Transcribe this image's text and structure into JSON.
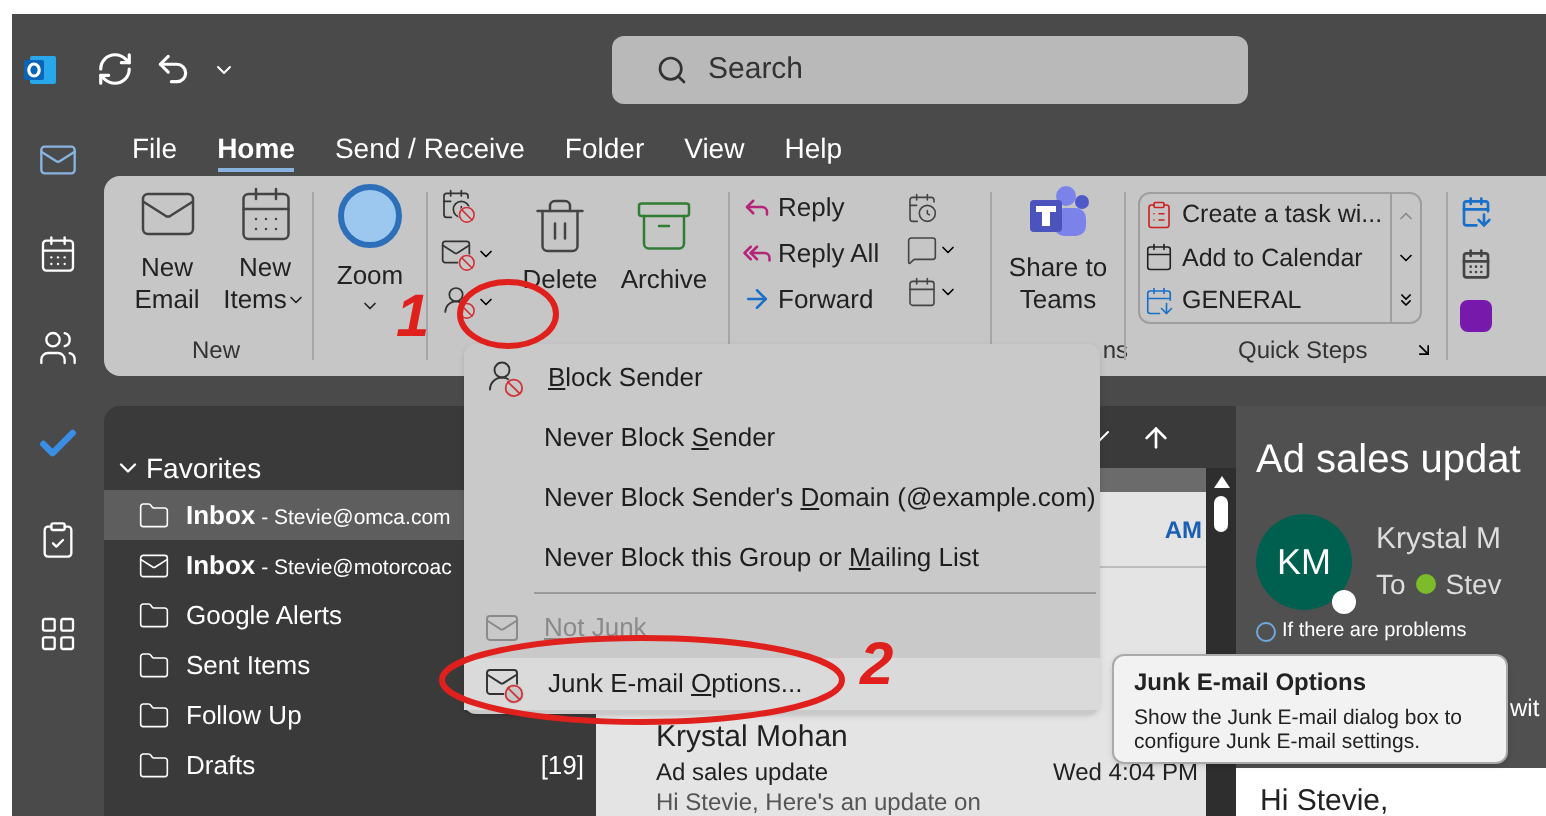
{
  "search": {
    "placeholder": "Search"
  },
  "tabs": [
    {
      "label": "File",
      "selected": false
    },
    {
      "label": "Home",
      "selected": true
    },
    {
      "label": "Send / Receive",
      "selected": false
    },
    {
      "label": "Folder",
      "selected": false
    },
    {
      "label": "View",
      "selected": false
    },
    {
      "label": "Help",
      "selected": false
    }
  ],
  "ribbon": {
    "new_group": {
      "label": "New",
      "buttons": [
        {
          "lines": [
            "New",
            "Email"
          ],
          "dropdown": false
        },
        {
          "lines": [
            "New",
            "Items"
          ],
          "dropdown": true
        }
      ]
    },
    "zoom": {
      "label": "Zoom"
    },
    "delete_group": {
      "buttons": [
        "Delete",
        "Archive"
      ]
    },
    "respond_group": {
      "buttons": [
        "Reply",
        "Reply All",
        "Forward"
      ]
    },
    "teams_group": {
      "lines": [
        "Share to",
        "Teams"
      ],
      "label": "ns"
    },
    "quick_steps": {
      "label": "Quick Steps",
      "items": [
        "Create a task wi...",
        "Add to Calendar",
        "GENERAL"
      ]
    }
  },
  "folders": {
    "header": "Favorites",
    "expanded": true,
    "items": [
      {
        "kind": "folder",
        "name": "Inbox",
        "account": " - Stevie@omca.com",
        "selected": true
      },
      {
        "kind": "mail",
        "name": "Inbox",
        "account": " - Stevie@motorcoac",
        "selected": false
      },
      {
        "kind": "folder",
        "name": "Google Alerts",
        "selected": false
      },
      {
        "kind": "folder",
        "name": "Sent Items",
        "selected": false
      },
      {
        "kind": "folder",
        "name": "Follow Up",
        "selected": false
      },
      {
        "kind": "folder",
        "name": "Drafts",
        "count": "[19]",
        "selected": false
      }
    ]
  },
  "message_list": {
    "time_fragment": "AM",
    "message": {
      "sender": "Krystal Mohan",
      "subject": "Ad sales update",
      "time": "Wed 4:04 PM",
      "preview": "Hi Stevie,  Here's an update on"
    }
  },
  "reading_pane": {
    "subject": "Ad sales updat",
    "initials": "KM",
    "sender": "Krystal M",
    "to_label": "To",
    "recipient": "Stev",
    "notice": "If there are problems",
    "notice_tail": "wit",
    "body": "Hi Stevie,"
  },
  "junk_menu": {
    "items": [
      {
        "kind": "person",
        "key": "B",
        "after": "lock Sender",
        "disabled": false,
        "selected": false
      },
      {
        "kind": "plain",
        "before": "Never Block ",
        "key": "S",
        "after": "ender",
        "disabled": false,
        "selected": false
      },
      {
        "kind": "plain",
        "before": "Never Block Sender's ",
        "key": "D",
        "after": "omain (@example.com)",
        "disabled": false,
        "selected": false
      },
      {
        "kind": "plain",
        "before": "Never Block this Group or ",
        "key": "M",
        "after": "ailing List",
        "disabled": false,
        "selected": false
      },
      {
        "kind": "separator"
      },
      {
        "kind": "envelope",
        "key": "N",
        "after": "ot Junk",
        "disabled": true,
        "selected": false
      },
      {
        "kind": "options",
        "before": "Junk E-mail ",
        "key": "O",
        "after": "ptions...",
        "disabled": false,
        "selected": true
      }
    ]
  },
  "tooltip": {
    "title": "Junk E-mail Options",
    "text": "Show the Junk E-mail dialog box to configure Junk E-mail settings."
  },
  "annotations": [
    {
      "label": "1"
    },
    {
      "label": "2"
    }
  ]
}
